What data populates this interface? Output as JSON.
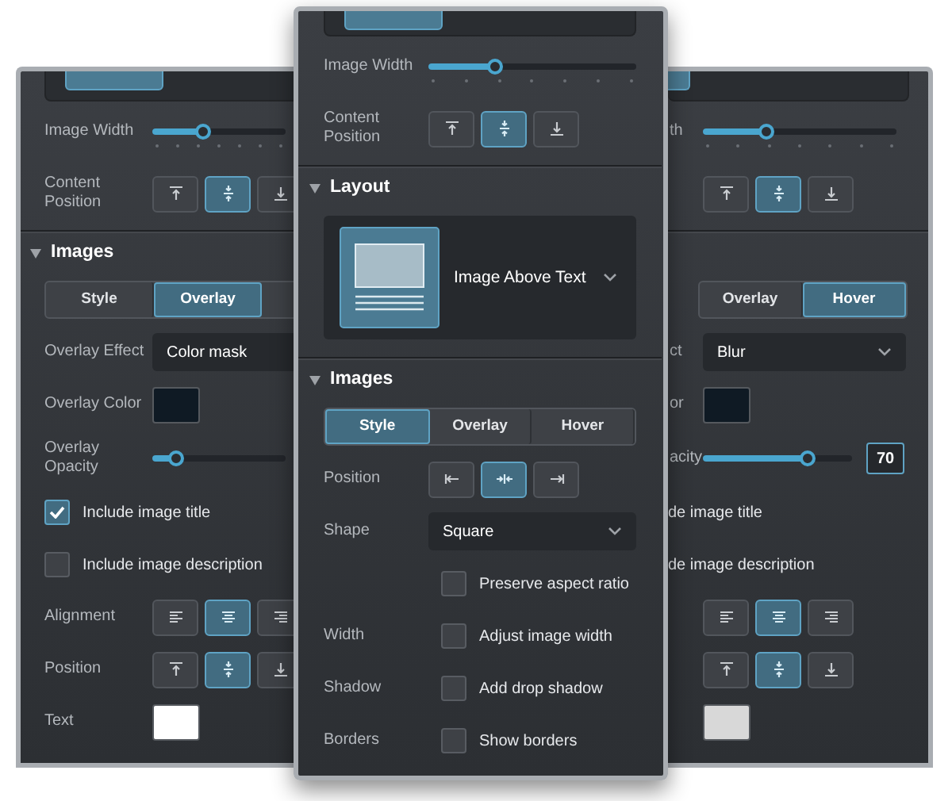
{
  "panels": [
    {
      "rows": [
        {
          "kind": "card"
        },
        {
          "kind": "slider_ticks",
          "label": "Image Width",
          "level": 0.38
        },
        {
          "kind": "buttons",
          "label": "Content Position",
          "buttons": [
            {
              "kind": "align-top",
              "selected": false
            },
            {
              "kind": "align-middle",
              "selected": true
            },
            {
              "kind": "align-bottom",
              "selected": false
            }
          ]
        },
        {
          "kind": "divider"
        },
        {
          "kind": "section",
          "title": "Images",
          "expanded": true
        },
        {
          "kind": "tabs",
          "tabs": [
            {
              "label": "Style",
              "selected": false
            },
            {
              "label": "Overlay",
              "selected": true
            }
          ]
        },
        {
          "kind": "dropdown",
          "label": "Overlay Effect",
          "value": "Color mask"
        },
        {
          "kind": "swatch",
          "label": "Overlay Color",
          "color": "#0f1a24"
        },
        {
          "kind": "slider",
          "label": "Overlay Opacity",
          "level": 0.18
        },
        {
          "kind": "checkbox",
          "text": "Include image title",
          "checked": true
        },
        {
          "kind": "checkbox",
          "text": "Include image description",
          "checked": false
        },
        {
          "kind": "buttons",
          "label": "Alignment",
          "buttons": [
            {
              "kind": "text-left",
              "selected": false
            },
            {
              "kind": "text-center",
              "selected": true
            },
            {
              "kind": "text-right",
              "selected": false
            }
          ]
        },
        {
          "kind": "buttons",
          "label": "Position",
          "buttons": [
            {
              "kind": "align-top",
              "selected": false
            },
            {
              "kind": "align-middle",
              "selected": true
            },
            {
              "kind": "align-bottom",
              "selected": false
            }
          ]
        },
        {
          "kind": "swatch",
          "label": "Text",
          "color": "#ffffff"
        }
      ]
    },
    {
      "rows": [
        {
          "kind": "card"
        },
        {
          "kind": "slider_ticks",
          "label": "Image Width",
          "level": 0.32
        },
        {
          "kind": "buttons",
          "label": "Content Position",
          "buttons": [
            {
              "kind": "align-top",
              "selected": false
            },
            {
              "kind": "align-middle",
              "selected": true
            },
            {
              "kind": "align-bottom",
              "selected": false
            }
          ]
        },
        {
          "kind": "divider"
        },
        {
          "kind": "section",
          "title": "Layout",
          "expanded": true
        },
        {
          "kind": "layout",
          "text": "Image Above Text"
        },
        {
          "kind": "divider"
        },
        {
          "kind": "section",
          "title": "Images",
          "expanded": true
        },
        {
          "kind": "tabs",
          "tabs": [
            {
              "label": "Style",
              "selected": true
            },
            {
              "label": "Overlay",
              "selected": false
            },
            {
              "label": "Hover",
              "selected": false
            }
          ]
        },
        {
          "kind": "buttons",
          "label": "Position",
          "buttons": [
            {
              "kind": "pin-left",
              "selected": false
            },
            {
              "kind": "pin-center",
              "selected": true
            },
            {
              "kind": "pin-right",
              "selected": false
            }
          ]
        },
        {
          "kind": "dropdown",
          "label": "Shape",
          "value": "Square"
        },
        {
          "kind": "checkbox",
          "text": "Preserve aspect ratio",
          "checked": false
        },
        {
          "kind": "checkbox",
          "label": "Width",
          "text": "Adjust image width",
          "checked": false
        },
        {
          "kind": "checkbox",
          "label": "Shadow",
          "text": "Add drop shadow",
          "checked": false
        },
        {
          "kind": "checkbox",
          "label": "Borders",
          "text": "Show borders",
          "checked": false
        }
      ]
    },
    {
      "rows": [
        {
          "kind": "card"
        },
        {
          "kind": "slider_ticks",
          "label": "th",
          "level": 0.33
        },
        {
          "kind": "buttons",
          "buttons": [
            {
              "kind": "align-top",
              "selected": false
            },
            {
              "kind": "align-middle",
              "selected": true
            },
            {
              "kind": "align-bottom",
              "selected": false
            }
          ]
        },
        {
          "kind": "divider"
        },
        {
          "kind": "gap"
        },
        {
          "kind": "tabs",
          "tabs": [
            {
              "label": "Overlay",
              "selected": false
            },
            {
              "label": "Hover",
              "selected": true
            }
          ]
        },
        {
          "kind": "dropdown",
          "label": "ct",
          "value": "Blur"
        },
        {
          "kind": "swatch",
          "label": "or",
          "color": "#0f1a24"
        },
        {
          "kind": "slider",
          "label": "acity",
          "level": 0.7,
          "value": "70"
        },
        {
          "kind": "checkbox",
          "text": "de image title"
        },
        {
          "kind": "checkbox",
          "text": "de image description"
        },
        {
          "kind": "buttons",
          "buttons": [
            {
              "kind": "text-left",
              "selected": false
            },
            {
              "kind": "text-center",
              "selected": true
            },
            {
              "kind": "text-right",
              "selected": false
            }
          ]
        },
        {
          "kind": "buttons",
          "buttons": [
            {
              "kind": "align-top",
              "selected": false
            },
            {
              "kind": "align-middle",
              "selected": true
            },
            {
              "kind": "align-bottom",
              "selected": false
            }
          ]
        },
        {
          "kind": "swatch",
          "color": "#d8d8d8"
        }
      ]
    }
  ]
}
